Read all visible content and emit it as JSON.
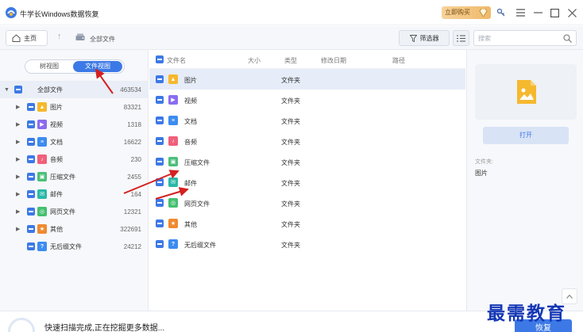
{
  "app": {
    "title": "牛学长Windows数据恢复",
    "buy_label": "立即购买"
  },
  "nav": {
    "home_label": "主页",
    "breadcrumb": "全部文件",
    "filter_label": "筛选器",
    "search_placeholder": "搜索"
  },
  "view_tabs": {
    "tree": "树视图",
    "file": "文件视图"
  },
  "tree": {
    "root": {
      "label": "全部文件",
      "count": "463534"
    },
    "items": [
      {
        "label": "图片",
        "count": "83321",
        "icon": "image-icon",
        "color": "#f5b82e"
      },
      {
        "label": "视频",
        "count": "1318",
        "icon": "video-icon",
        "color": "#8a6cf0"
      },
      {
        "label": "文档",
        "count": "16622",
        "icon": "document-icon",
        "color": "#3c8cf0"
      },
      {
        "label": "音频",
        "count": "230",
        "icon": "audio-icon",
        "color": "#f0607a"
      },
      {
        "label": "压缩文件",
        "count": "2455",
        "icon": "archive-icon",
        "color": "#4cbf7a"
      },
      {
        "label": "邮件",
        "count": "164",
        "icon": "mail-icon",
        "color": "#2bb8a8"
      },
      {
        "label": "网页文件",
        "count": "12321",
        "icon": "web-icon",
        "color": "#44c070"
      },
      {
        "label": "其他",
        "count": "322691",
        "icon": "other-icon",
        "color": "#f08a30"
      },
      {
        "label": "无后缀文件",
        "count": "24212",
        "icon": "unknown-icon",
        "color": "#3c8cf0"
      }
    ]
  },
  "list": {
    "columns": [
      "文件名",
      "大小",
      "类型",
      "修改日期",
      "路径"
    ],
    "rows": [
      {
        "name": "图片",
        "type": "文件夹"
      },
      {
        "name": "视频",
        "type": "文件夹"
      },
      {
        "name": "文档",
        "type": "文件夹"
      },
      {
        "name": "音频",
        "type": "文件夹"
      },
      {
        "name": "压缩文件",
        "type": "文件夹"
      },
      {
        "name": "邮件",
        "type": "文件夹"
      },
      {
        "name": "网页文件",
        "type": "文件夹"
      },
      {
        "name": "其他",
        "type": "文件夹"
      },
      {
        "name": "无后缀文件",
        "type": "文件夹"
      }
    ]
  },
  "preview": {
    "open_label": "打开",
    "info_label": "文件夹:",
    "info_value": "图片"
  },
  "status": {
    "text": "快速扫描完成,正在挖掘更多数据...",
    "recover_label": "恢复",
    "watermark": "最需教育"
  },
  "colors": {
    "accent": "#3c79e6",
    "annotation": "#d42020"
  }
}
